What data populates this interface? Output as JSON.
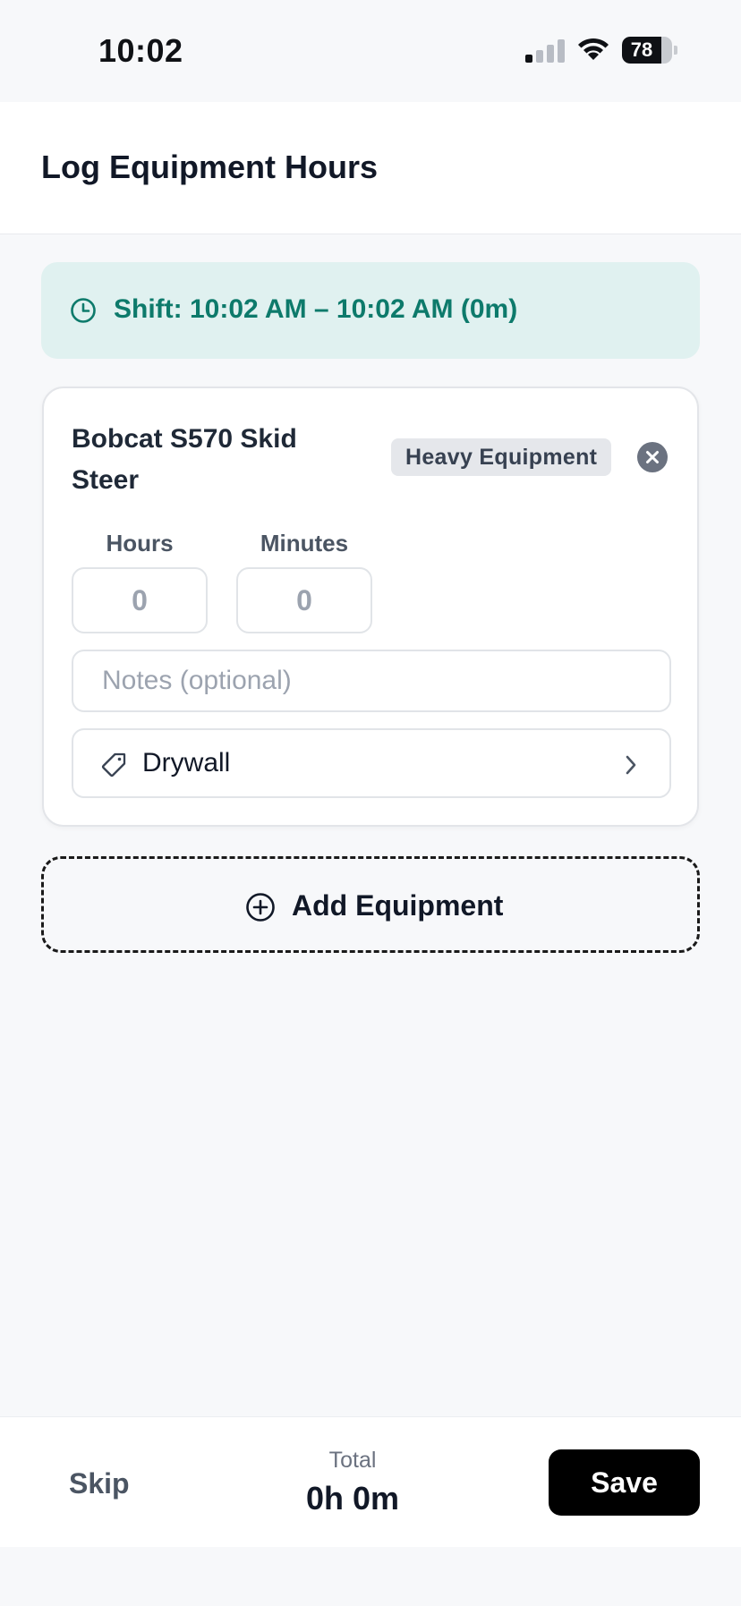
{
  "status_bar": {
    "time": "10:02",
    "battery_level": "78",
    "battery_fraction": 0.78,
    "signal_bars_active": 1,
    "signal_bars_total": 4
  },
  "header": {
    "title": "Log Equipment Hours"
  },
  "shift_banner": {
    "text": "Shift: 10:02 AM – 10:02 AM (0m)",
    "icon": "clock-icon"
  },
  "equipment_items": [
    {
      "name": "Bobcat S570 Skid Steer",
      "category_badge": "Heavy Equipment",
      "hours_label": "Hours",
      "hours_value": "0",
      "minutes_label": "Minutes",
      "minutes_value": "0",
      "notes_placeholder": "Notes (optional)",
      "tag_value": "Drywall"
    }
  ],
  "add_equipment": {
    "label": "Add Equipment",
    "icon": "plus-circle-icon"
  },
  "footer": {
    "skip_label": "Skip",
    "total_label": "Total",
    "total_value": "0h 0m",
    "save_label": "Save"
  },
  "colors": {
    "accent_teal": "#0d7a6b",
    "banner_bg": "#e0f1f0",
    "primary_button": "#000000"
  }
}
